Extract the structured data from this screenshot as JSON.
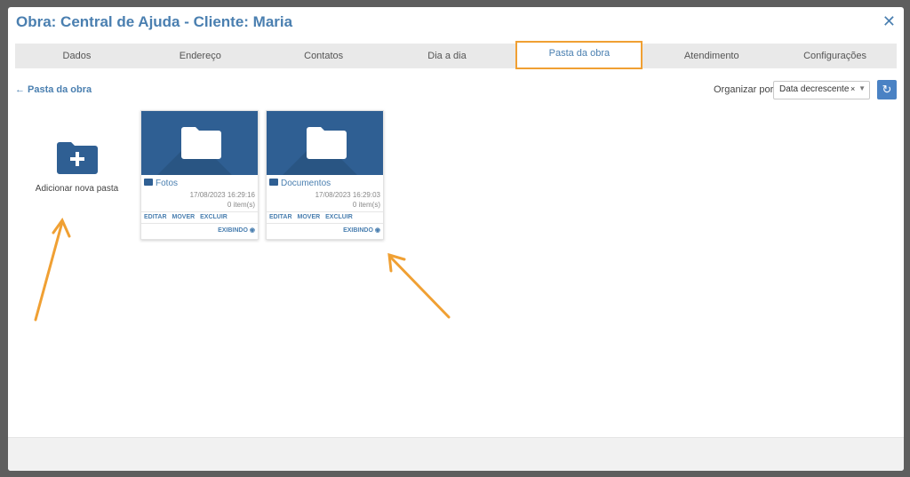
{
  "modal": {
    "title": "Obra: Central de Ajuda - Cliente: Maria",
    "close_icon": "close-icon"
  },
  "tabs": [
    {
      "label": "Dados"
    },
    {
      "label": "Endereço"
    },
    {
      "label": "Contatos"
    },
    {
      "label": "Dia a dia"
    },
    {
      "label": "Pasta da obra",
      "active": true
    },
    {
      "label": "Atendimento"
    },
    {
      "label": "Configurações"
    }
  ],
  "nav": {
    "back_label": "Pasta da obra",
    "back_icon": "arrow-left-icon"
  },
  "sort": {
    "label": "Organizar por",
    "selected": "Data decrescente",
    "clear": "×",
    "refresh_icon": "refresh-icon"
  },
  "add_folder": {
    "label": "Adicionar nova pasta",
    "icon": "folder-plus-icon"
  },
  "folders": [
    {
      "name": "Fotos",
      "date": "17/08/2023 16:29:16",
      "count": "0 item(s)",
      "edit": "EDITAR",
      "move": "MOVER",
      "delete": "EXCLUIR",
      "view": "EXIBINDO"
    },
    {
      "name": "Documentos",
      "date": "17/08/2023 16:29:03",
      "count": "0 item(s)",
      "edit": "EDITAR",
      "move": "MOVER",
      "delete": "EXCLUIR",
      "view": "EXIBINDO"
    }
  ],
  "colors": {
    "accent": "#4a7fb0",
    "folder_bg": "#2f5f93",
    "highlight": "#f0a033"
  }
}
